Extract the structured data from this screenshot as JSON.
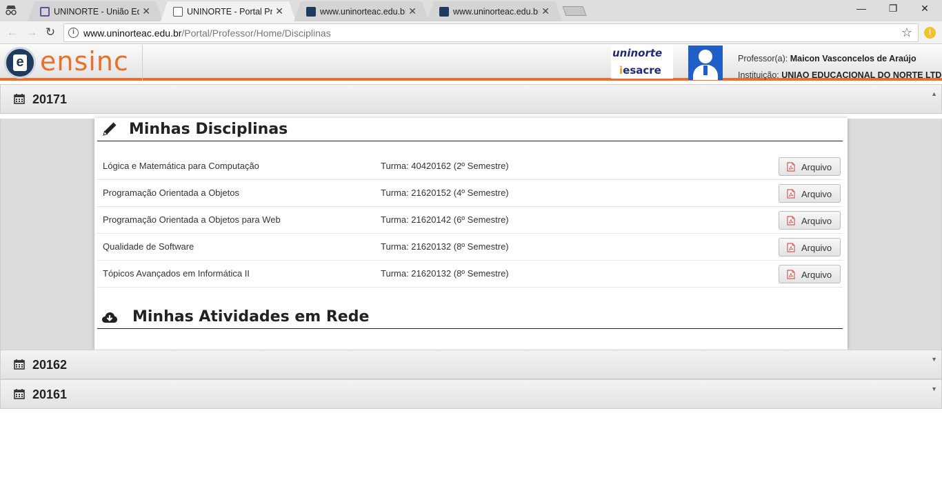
{
  "browser": {
    "tabs": [
      {
        "title": "UNINORTE - União Educ",
        "favicon_color": "#6a4aa0",
        "active": false
      },
      {
        "title": "UNINORTE - Portal Profe",
        "favicon_color": "#ffffff",
        "active": true
      },
      {
        "title": "www.uninorteac.edu.br/P",
        "favicon_color": "#1f3b5e",
        "active": false
      },
      {
        "title": "www.uninorteac.edu.br/P",
        "favicon_color": "#1f3b5e",
        "active": false
      }
    ],
    "url_host": "www.uninorteac.edu.br",
    "url_path": "/Portal/Professor/Home/Disciplinas",
    "ext_badge": "!"
  },
  "header": {
    "logo_letter": "e",
    "logo_text": "ensinc",
    "inst_logo_1": "uninorte",
    "inst_logo_2_prefix": "i",
    "inst_logo_2": "esacre",
    "professor_label": "Professor(a):",
    "professor_name": "Maicon Vasconcelos de Araújo",
    "institution_label": "Instituição:",
    "institution_name": "UNIAO EDUCACIONAL DO NORTE LTDA"
  },
  "semesters": [
    {
      "label": "20171",
      "expanded": true
    },
    {
      "label": "20162",
      "expanded": false
    },
    {
      "label": "20161",
      "expanded": false
    }
  ],
  "disciplinas": {
    "title": "Minhas Disciplinas",
    "button_label": "Arquivo",
    "rows": [
      {
        "name": "Lógica e Matemática para Computação",
        "turma": "Turma: 40420162 (2º Semestre)"
      },
      {
        "name": "Programação Orientada a Objetos",
        "turma": "Turma: 21620152 (4º Semestre)"
      },
      {
        "name": "Programação Orientada a Objetos para Web",
        "turma": "Turma: 21620142 (6º Semestre)"
      },
      {
        "name": "Qualidade de Software",
        "turma": "Turma: 21620132 (8º Semestre)"
      },
      {
        "name": "Tópicos Avançados em Informática II",
        "turma": "Turma: 21620132 (8º Semestre)"
      }
    ]
  },
  "atividades": {
    "title": "Minhas Atividades em Rede"
  },
  "colors": {
    "accent_orange": "#e8702a",
    "brand_navy": "#1f3b5e",
    "avatar_blue": "#1f5fc7"
  }
}
